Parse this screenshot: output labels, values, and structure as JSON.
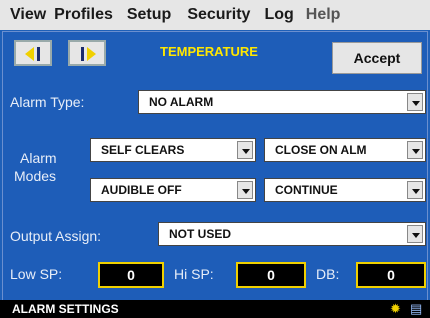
{
  "menu": {
    "items": [
      "View",
      "Profiles",
      "Setup",
      "Security",
      "Log",
      "Help"
    ]
  },
  "header": {
    "title": "TEMPERATURE",
    "accept_label": "Accept"
  },
  "alarm_type": {
    "label": "Alarm Type:",
    "value": "NO ALARM"
  },
  "alarm_modes": {
    "label_line1": "Alarm",
    "label_line2": "Modes",
    "selects": [
      "SELF CLEARS",
      "CLOSE ON ALM",
      "AUDIBLE OFF",
      "CONTINUE"
    ]
  },
  "output_assign": {
    "label": "Output Assign:",
    "value": "NOT USED"
  },
  "setpoints": {
    "low_label": "Low SP:",
    "low_value": "0",
    "hi_label": "Hi SP:",
    "hi_value": "0",
    "db_label": "DB:",
    "db_value": "0"
  },
  "status_bar": {
    "text": "ALARM SETTINGS",
    "icons": [
      "alarm-light-icon",
      "printer-icon"
    ],
    "colors": {
      "accent": "#ffe700",
      "background": "#1e5db8"
    }
  }
}
